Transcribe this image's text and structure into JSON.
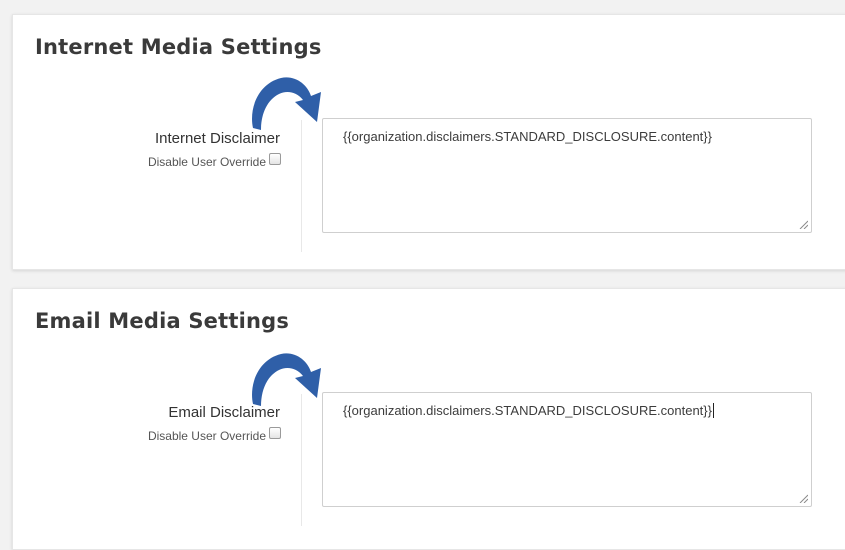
{
  "colors": {
    "arrow": "#2f5fa8",
    "panel_bg": "#ffffff",
    "page_bg": "#f2f2f2"
  },
  "internet": {
    "title": "Internet Media Settings",
    "field_label": "Internet Disclaimer",
    "override_label": "Disable User Override",
    "override_checked": false,
    "disclaimer_value": "{{organization.disclaimers.STANDARD_DISCLOSURE.content}}"
  },
  "email": {
    "title": "Email Media Settings",
    "field_label": "Email Disclaimer",
    "override_label": "Disable User Override",
    "override_checked": false,
    "disclaimer_value": "{{organization.disclaimers.STANDARD_DISCLOSURE.content}}",
    "focused": true
  }
}
